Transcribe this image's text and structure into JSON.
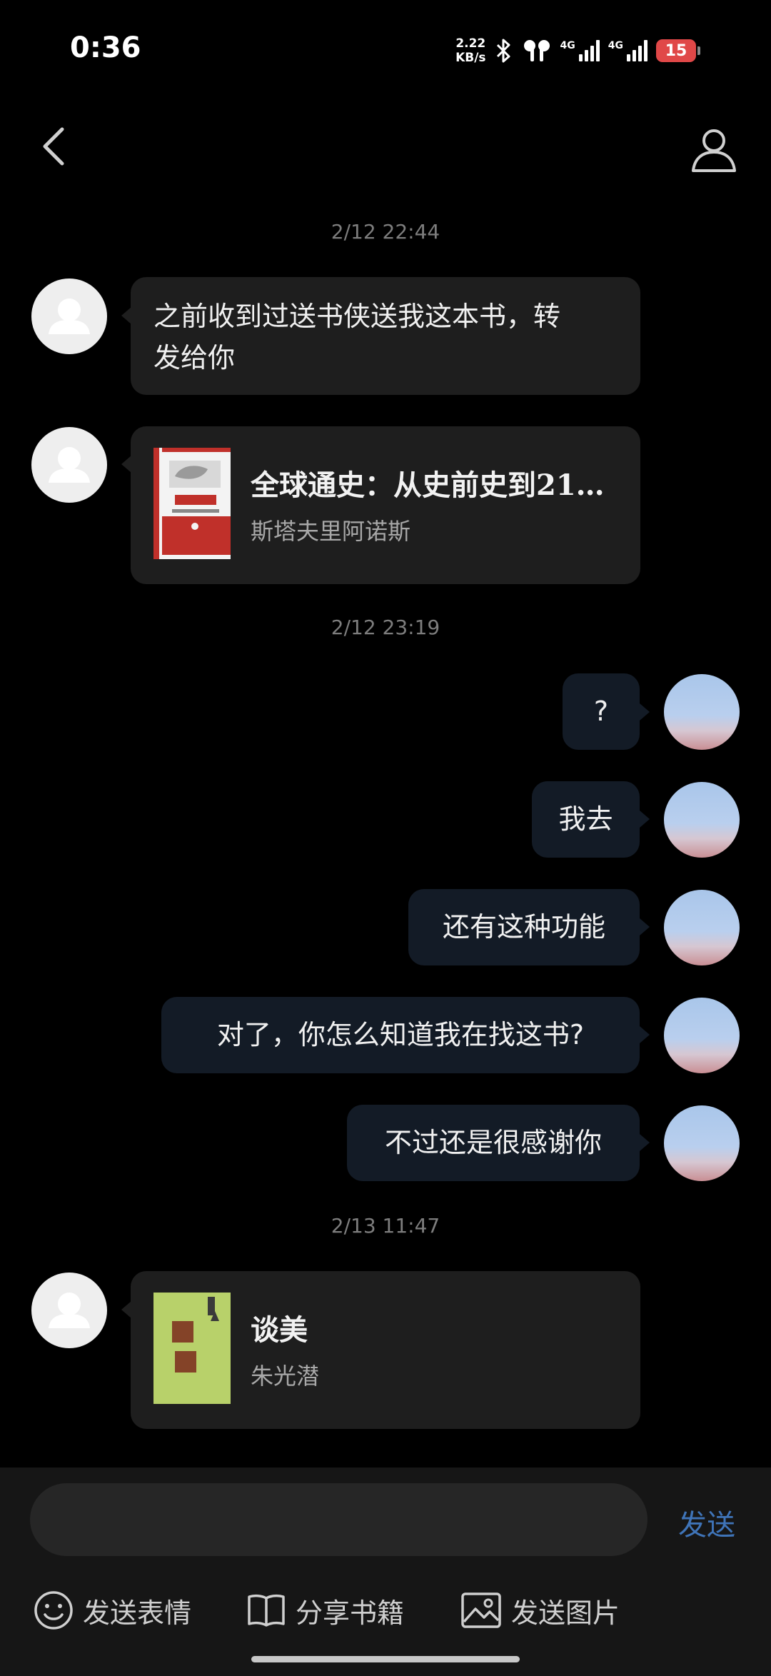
{
  "status_bar": {
    "time": "0:36",
    "net_speed_value": "2.22",
    "net_speed_unit": "KB/s",
    "network_1": "4G",
    "network_2": "4G",
    "battery": "15"
  },
  "timestamps": [
    "2/12 22:44",
    "2/12 23:19",
    "2/13 11:47"
  ],
  "messages": [
    {
      "text_line1": "之前收到过送书侠送我这本书，转",
      "text_line2": "发给你"
    },
    {
      "book_title": "全球通史：从史前史到21…",
      "book_author": "斯塔夫里阿诺斯"
    },
    {
      "text": "?"
    },
    {
      "text": "我去"
    },
    {
      "text": "还有这种功能"
    },
    {
      "text": "对了，你怎么知道我在找这书?"
    },
    {
      "text": "不过还是很感谢你"
    },
    {
      "book_title": "谈美",
      "book_author": "朱光潜"
    }
  ],
  "input": {
    "placeholder": "",
    "value": "",
    "send_label": "发送"
  },
  "actions": [
    {
      "label": "发送表情",
      "icon": "smiley-icon"
    },
    {
      "label": "分享书籍",
      "icon": "book-icon"
    },
    {
      "label": "发送图片",
      "icon": "image-icon"
    }
  ],
  "colors": {
    "background": "#000000",
    "incoming_bubble": "#1e1e1e",
    "outgoing_bubble": "#131b26",
    "accent": "#3f74b8",
    "battery_low": "#e04848"
  }
}
